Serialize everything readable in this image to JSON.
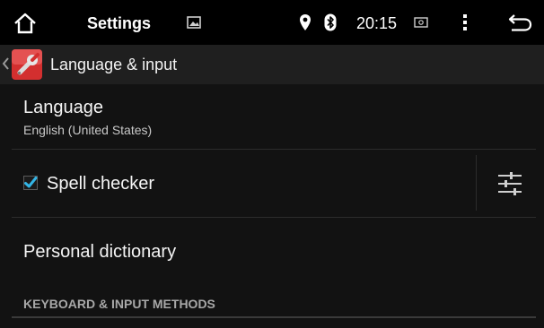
{
  "status_bar": {
    "title": "Settings",
    "time": "20:15",
    "icons": [
      "home-icon",
      "gallery-icon",
      "location-icon",
      "bluetooth-icon",
      "cast-icon",
      "overflow-menu-icon",
      "back-icon"
    ]
  },
  "action_bar": {
    "title": "Language & input",
    "icons": [
      "up-caret-icon",
      "settings-wrench-app-icon"
    ]
  },
  "list": {
    "language": {
      "title": "Language",
      "summary": "English (United States)"
    },
    "spell_checker": {
      "label": "Spell checker",
      "checked": true,
      "settings_icon": "equalizer-settings-icon"
    },
    "personal_dictionary": {
      "label": "Personal dictionary"
    },
    "section_header": "KEYBOARD & INPUT METHODS"
  },
  "colors": {
    "accent": "#33b5e5",
    "background": "#121212",
    "status_bar": "#000000",
    "action_bar": "#1f1f1f",
    "app_icon_bg": "#d32f2f"
  }
}
